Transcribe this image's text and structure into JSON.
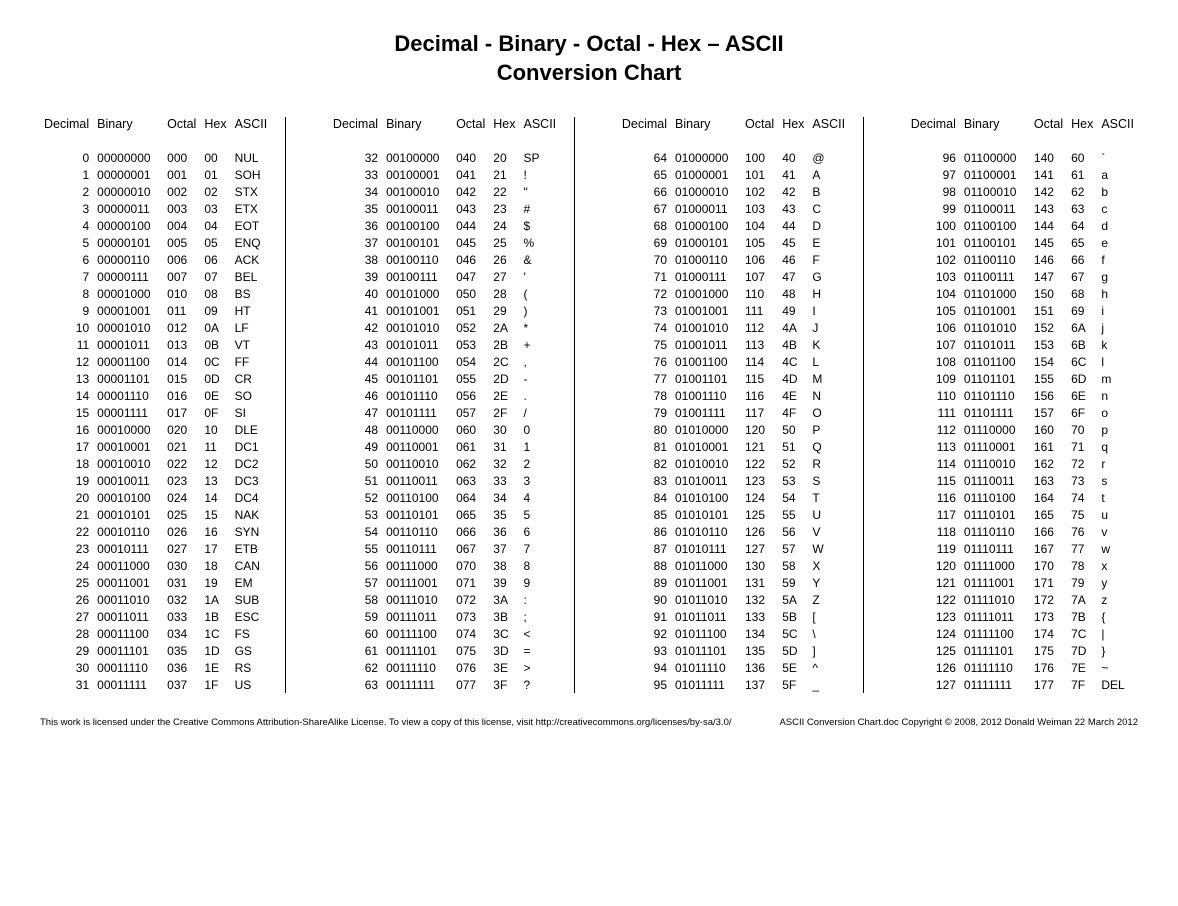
{
  "title_line1": "Decimal - Binary - Octal - Hex – ASCII",
  "title_line2": "Conversion Chart",
  "headers": [
    "Decimal",
    "Binary",
    "Octal",
    "Hex",
    "ASCII"
  ],
  "ascii": [
    "NUL",
    "SOH",
    "STX",
    "ETX",
    "EOT",
    "ENQ",
    "ACK",
    "BEL",
    "BS",
    "HT",
    "LF",
    "VT",
    "FF",
    "CR",
    "SO",
    "SI",
    "DLE",
    "DC1",
    "DC2",
    "DC3",
    "DC4",
    "NAK",
    "SYN",
    "ETB",
    "CAN",
    "EM",
    "SUB",
    "ESC",
    "FS",
    "GS",
    "RS",
    "US",
    "SP",
    "!",
    "\"",
    "#",
    "$",
    "%",
    "&",
    "'",
    "(",
    ")",
    "*",
    "+",
    ",",
    "-",
    ".",
    "/",
    "0",
    "1",
    "2",
    "3",
    "4",
    "5",
    "6",
    "7",
    "8",
    "9",
    ":",
    ";",
    "<",
    "=",
    ">",
    "?",
    "@",
    "A",
    "B",
    "C",
    "D",
    "E",
    "F",
    "G",
    "H",
    "I",
    "J",
    "K",
    "L",
    "M",
    "N",
    "O",
    "P",
    "Q",
    "R",
    "S",
    "T",
    "U",
    "V",
    "W",
    "X",
    "Y",
    "Z",
    "[",
    "\\",
    "]",
    "^",
    "_",
    "`",
    "a",
    "b",
    "c",
    "d",
    "e",
    "f",
    "g",
    "h",
    "i",
    "j",
    "k",
    "l",
    "m",
    "n",
    "o",
    "p",
    "q",
    "r",
    "s",
    "t",
    "u",
    "v",
    "w",
    "x",
    "y",
    "z",
    "{",
    "|",
    "}",
    "~",
    "DEL"
  ],
  "footer_left": "This work is licensed under the Creative Commons Attribution-ShareAlike License.  To view a copy of this license, visit  http://creativecommons.org/licenses/by-sa/3.0/",
  "footer_right": "ASCII Conversion Chart.doc    Copyright © 2008, 2012    Donald Weiman    22 March 2012",
  "chart_data": {
    "type": "table",
    "title": "Decimal - Binary - Octal - Hex – ASCII Conversion Chart",
    "columns": [
      "Decimal",
      "Binary",
      "Octal",
      "Hex",
      "ASCII"
    ],
    "range": [
      0,
      127
    ],
    "note": "Each row n: Decimal=n, Binary=8-bit zero-padded, Octal=3-digit zero-padded, Hex=2-digit uppercase zero-padded, ASCII per the ascii[] array above."
  }
}
